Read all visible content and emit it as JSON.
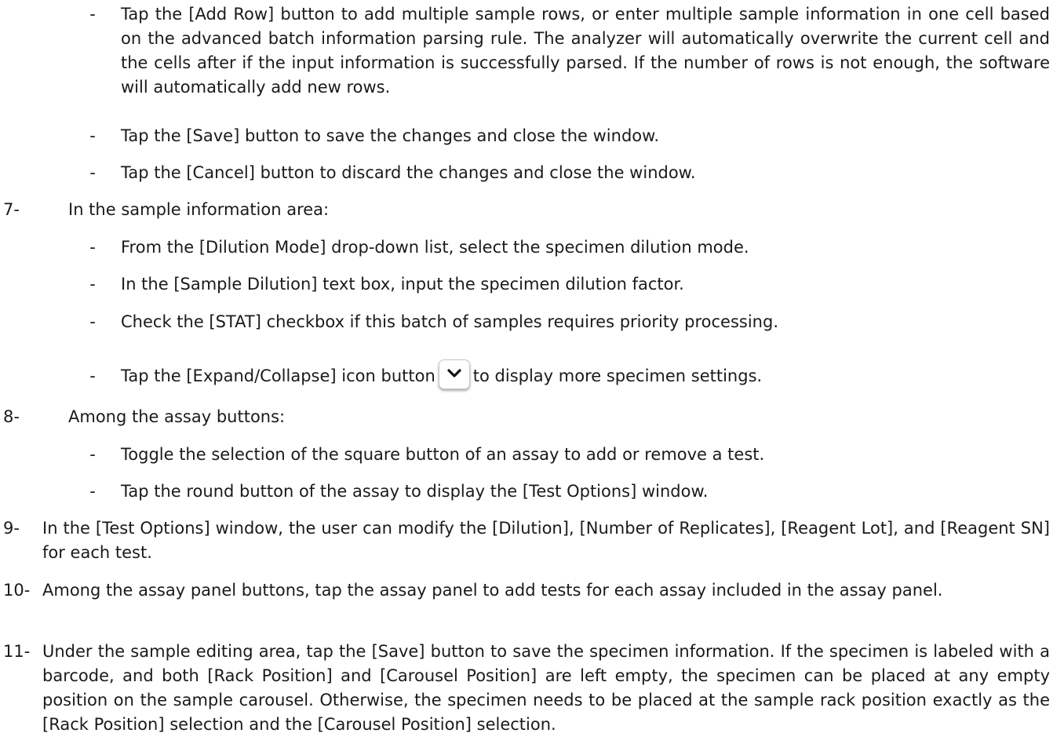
{
  "bullet_char": "-",
  "add_row": {
    "text": "Tap the [Add Row] button to add multiple sample rows, or enter multiple sample information in one cell based on the advanced batch information parsing rule. The analyzer will automatically overwrite the current cell and the cells after if the input information is successfully parsed. If the number of rows is not enough, the software will automatically add new rows."
  },
  "save_bullet": {
    "text": "Tap the [Save] button to save the changes and close the window."
  },
  "cancel_bullet": {
    "text": "Tap the [Cancel] button to discard the changes and close the window."
  },
  "step7": {
    "number": "7-",
    "text": "In the sample information area:",
    "bullets": [
      "From the [Dilution Mode] drop-down list, select the specimen dilution mode.",
      "In the [Sample Dilution] text box, input the specimen dilution factor.",
      "Check the [STAT] checkbox if this batch of samples requires priority processing."
    ],
    "expand_before": "Tap the [Expand/Collapse] icon button",
    "expand_after": "to display more specimen settings.",
    "expand_icon": "chevron-down-icon"
  },
  "step8": {
    "number": "8-",
    "text": "Among the assay buttons:",
    "bullets": [
      "Toggle the selection of the square button of an assay to add or remove a test.",
      "Tap the round button of the assay to display the [Test Options] window."
    ]
  },
  "step9": {
    "number": "9-",
    "text": "In the [Test Options] window, the user can modify the [Dilution], [Number of Replicates], [Reagent Lot], and [Reagent SN] for each test."
  },
  "step10": {
    "number": "10-",
    "text": "Among the assay panel buttons, tap the assay panel to add tests for each assay included in the assay panel."
  },
  "step11": {
    "number": "11-",
    "text": "Under the sample editing area, tap the [Save] button to save the specimen information. If the specimen is labeled with a barcode, and both [Rack Position] and [Carousel Position] are left empty, the specimen can be placed at any empty position on the sample carousel. Otherwise, the specimen needs to be placed at the sample rack position exactly as the [Rack Position] selection and the [Carousel Position] selection."
  }
}
